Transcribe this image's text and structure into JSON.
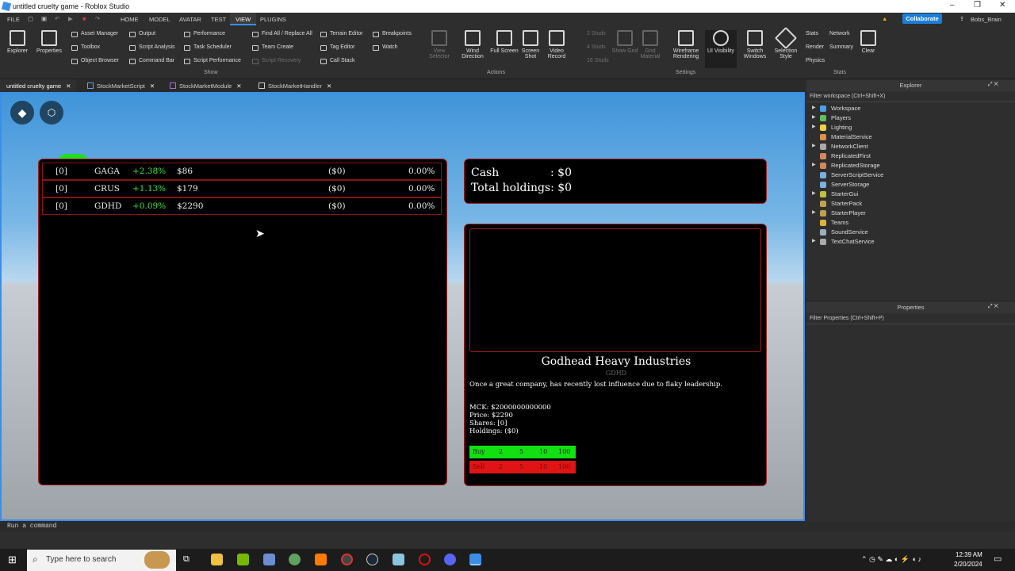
{
  "window": {
    "title": "untitled cruelty game - Roblox Studio",
    "controls": [
      "–",
      "❐",
      "✕"
    ]
  },
  "menu": {
    "file": "FILE",
    "tabs": [
      "HOME",
      "MODEL",
      "AVATAR",
      "TEST",
      "VIEW",
      "PLUGINS"
    ],
    "active": "VIEW",
    "collaborate": "Collaborate",
    "user": "Bobs_Brain"
  },
  "ribbon": {
    "explorer": "Explorer",
    "properties": "Properties",
    "show_col1": [
      "Asset Manager",
      "Toolbox",
      "Object Browser"
    ],
    "show_col2": [
      "Output",
      "Script Analysis",
      "Command Bar"
    ],
    "show_col3": [
      "Performance",
      "Task Scheduler",
      "Script Performance"
    ],
    "show_col4": [
      "Find All / Replace All",
      "Team Create",
      "Script Recovery"
    ],
    "show_col5": [
      "Terrain Editor",
      "Tag Editor",
      "Call Stack"
    ],
    "show_col6": [
      "Breakpoints",
      "Watch"
    ],
    "group_show": "Show",
    "view_selector": "View Selector",
    "wind_direction": "Wind Direction",
    "full_screen": "Full Screen",
    "screen_shot": "Screen Shot",
    "video_record": "Video Record",
    "group_actions": "Actions",
    "studs": [
      "2 Studs",
      "4 Studs",
      "16 Studs"
    ],
    "show_grid": "Show Grid",
    "grid_material": "Grid Material",
    "wireframe": "Wireframe Rendering",
    "ui_visibility": "UI Visibility",
    "switch_windows": "Switch Windows",
    "selection_style": "Selection Style",
    "group_settings": "Settings",
    "stats_items": [
      "Stats",
      "Network",
      "Render",
      "Summary",
      "Physics"
    ],
    "clear": "Clear",
    "group_stats": "Stats"
  },
  "doc_tabs": [
    "untitled cruelty game",
    "StockMarketScript",
    "StockMarketModule",
    "StockMarketHandler"
  ],
  "stocks": [
    {
      "shares": "[0]",
      "ticker": "GAGA",
      "change": "+2.38%",
      "price": "$86",
      "holdings": "($0)",
      "pct": "0.00%"
    },
    {
      "shares": "[0]",
      "ticker": "CRUS",
      "change": "+1.13%",
      "price": "$179",
      "holdings": "($0)",
      "pct": "0.00%"
    },
    {
      "shares": "[0]",
      "ticker": "GDHD",
      "change": "+0.09%",
      "price": "$2290",
      "holdings": "($0)",
      "pct": "0.00%"
    }
  ],
  "summary": {
    "cash_label": "Cash",
    "cash_value": ": $0",
    "total_label": "Total holdings: $0"
  },
  "detail": {
    "name": "Godhead Heavy Industries",
    "ticker": "GDHD",
    "description": "Once a great company, has recently lost influence due to flaky leadership.",
    "mck": "MCK: $2000000000000",
    "price": "Price: $2290",
    "shares": "Shares: [0]",
    "holdings": "Holdings: ($0)",
    "buy": [
      "Buy",
      "2",
      "5",
      "10",
      "100"
    ],
    "sell": [
      "Sell",
      "2",
      "5",
      "10",
      "100"
    ]
  },
  "explorer": {
    "title": "Explorer",
    "filter": "Filter workspace (Ctrl+Shift+X)",
    "items": [
      "Workspace",
      "Players",
      "Lighting",
      "MaterialService",
      "NetworkClient",
      "ReplicatedFirst",
      "ReplicatedStorage",
      "ServerScriptService",
      "ServerStorage",
      "StarterGui",
      "StarterPack",
      "StarterPlayer",
      "Teams",
      "SoundService",
      "TextChatService"
    ]
  },
  "properties": {
    "title": "Properties",
    "filter": "Filter Properties (Ctrl+Shift+P)"
  },
  "command_bar": {
    "placeholder": "Run a command"
  },
  "taskbar": {
    "search": "Type here to search",
    "time": "12:39 AM",
    "date": "2/20/2024"
  },
  "colors": {
    "accent": "#3b8ee8",
    "positive": "#3ee03e",
    "buy": "#12e012",
    "sell": "#e01414",
    "panel_border": "#a01d1d"
  }
}
